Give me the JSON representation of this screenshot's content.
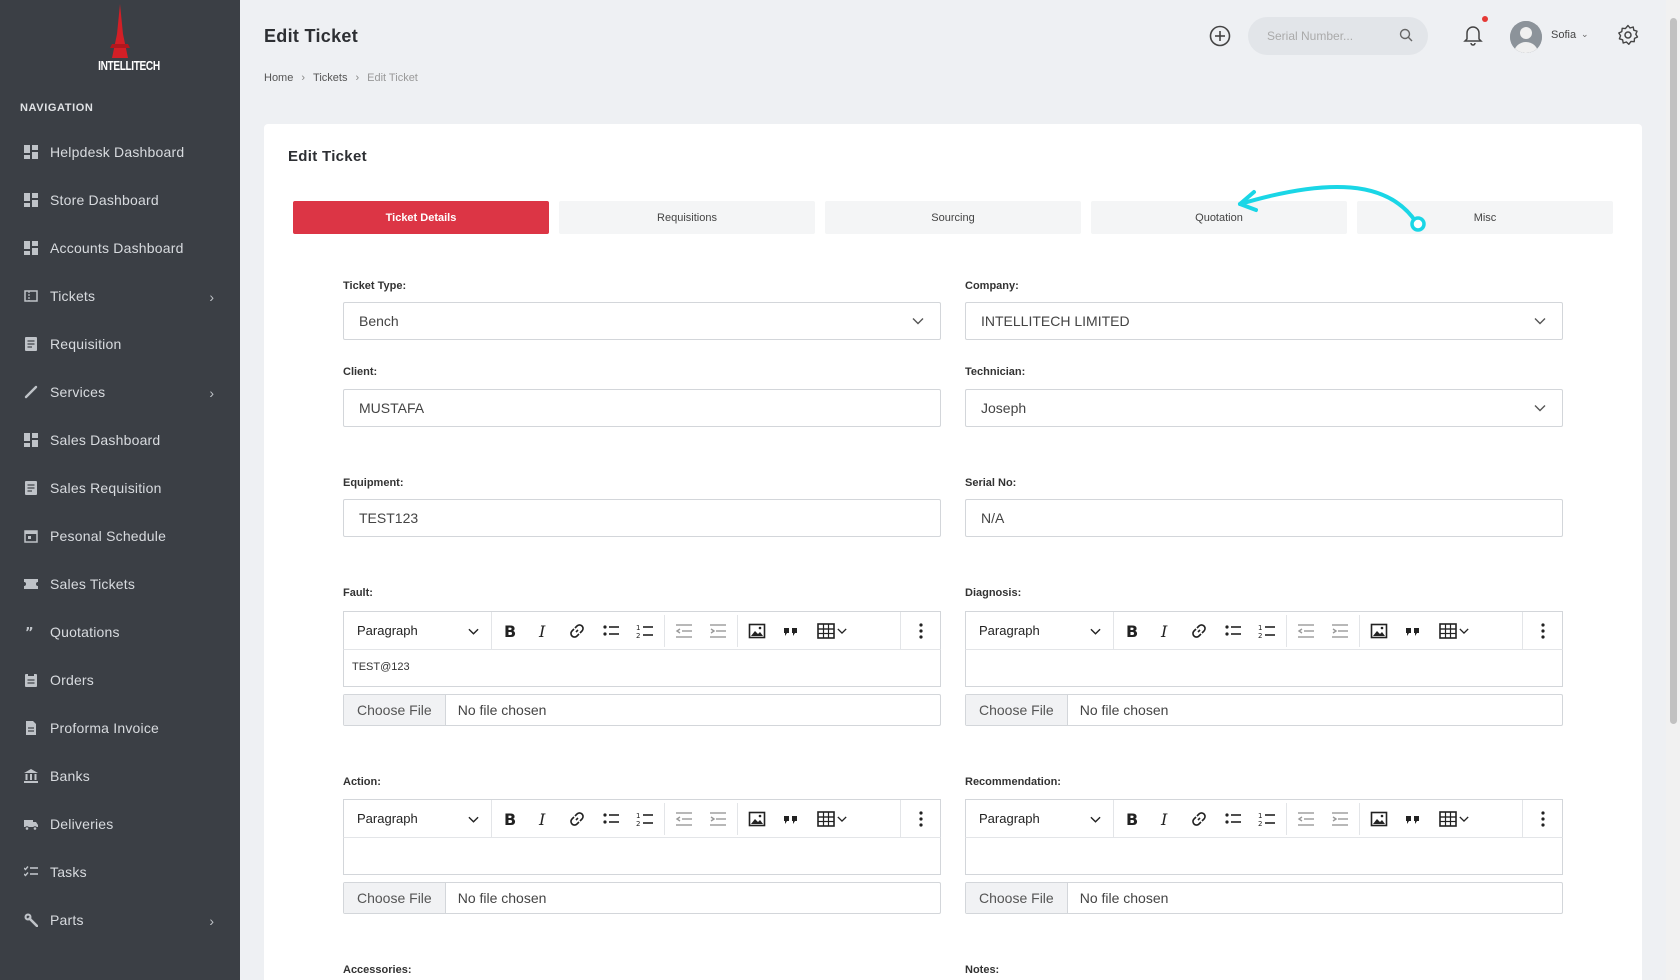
{
  "brand": {
    "logo_text": "INTELLITECH"
  },
  "sidebar": {
    "heading": "NAVIGATION",
    "items": [
      {
        "label": "Helpdesk Dashboard",
        "icon": "dashboard-icon"
      },
      {
        "label": "Store Dashboard",
        "icon": "dashboard-icon"
      },
      {
        "label": "Accounts Dashboard",
        "icon": "dashboard-icon"
      },
      {
        "label": "Tickets",
        "icon": "ticket-icon",
        "expandable": true
      },
      {
        "label": "Requisition",
        "icon": "document-icon"
      },
      {
        "label": "Services",
        "icon": "wrench-pen-icon",
        "expandable": true
      },
      {
        "label": "Sales Dashboard",
        "icon": "dashboard-icon"
      },
      {
        "label": "Sales Requisition",
        "icon": "document-icon"
      },
      {
        "label": "Pesonal Schedule",
        "icon": "calendar-icon"
      },
      {
        "label": "Sales Tickets",
        "icon": "ticket-icon"
      },
      {
        "label": "Quotations",
        "icon": "quote-icon"
      },
      {
        "label": "Orders",
        "icon": "clipboard-icon"
      },
      {
        "label": "Proforma Invoice",
        "icon": "file-icon"
      },
      {
        "label": "Banks",
        "icon": "bank-icon"
      },
      {
        "label": "Deliveries",
        "icon": "truck-icon"
      },
      {
        "label": "Tasks",
        "icon": "list-check-icon"
      },
      {
        "label": "Parts",
        "icon": "wrench-icon",
        "expandable": true
      }
    ]
  },
  "header": {
    "title": "Edit Ticket",
    "breadcrumb": [
      "Home",
      "Tickets",
      "Edit Ticket"
    ],
    "search_placeholder": "Serial Number...",
    "user_name": "Sofia"
  },
  "card": {
    "title": "Edit Ticket",
    "tabs": [
      "Ticket Details",
      "Requisitions",
      "Sourcing",
      "Quotation",
      "Misc"
    ],
    "active_tab": "Ticket Details"
  },
  "form": {
    "ticket_type": {
      "label": "Ticket Type:",
      "value": "Bench"
    },
    "company": {
      "label": "Company:",
      "value": "INTELLITECH LIMITED"
    },
    "client": {
      "label": "Client:",
      "value": "MUSTAFA"
    },
    "technician": {
      "label": "Technician:",
      "value": "Joseph"
    },
    "equipment": {
      "label": "Equipment:",
      "value": "TEST123"
    },
    "serial_no": {
      "label": "Serial No:",
      "value": "N/A"
    },
    "fault": {
      "label": "Fault:",
      "content": "TEST@123"
    },
    "diagnosis": {
      "label": "Diagnosis:",
      "content": ""
    },
    "action": {
      "label": "Action:",
      "content": ""
    },
    "recommendation": {
      "label": "Recommendation:",
      "content": ""
    },
    "accessories": {
      "label": "Accessories:"
    },
    "notes": {
      "label": "Notes:"
    }
  },
  "editor": {
    "paragraph_label": "Paragraph"
  },
  "file": {
    "button_label": "Choose File",
    "status": "No file chosen"
  },
  "colors": {
    "sidebar_bg": "#3b3f45",
    "accent": "#dc3545",
    "annotation": "#1ad6e6"
  }
}
